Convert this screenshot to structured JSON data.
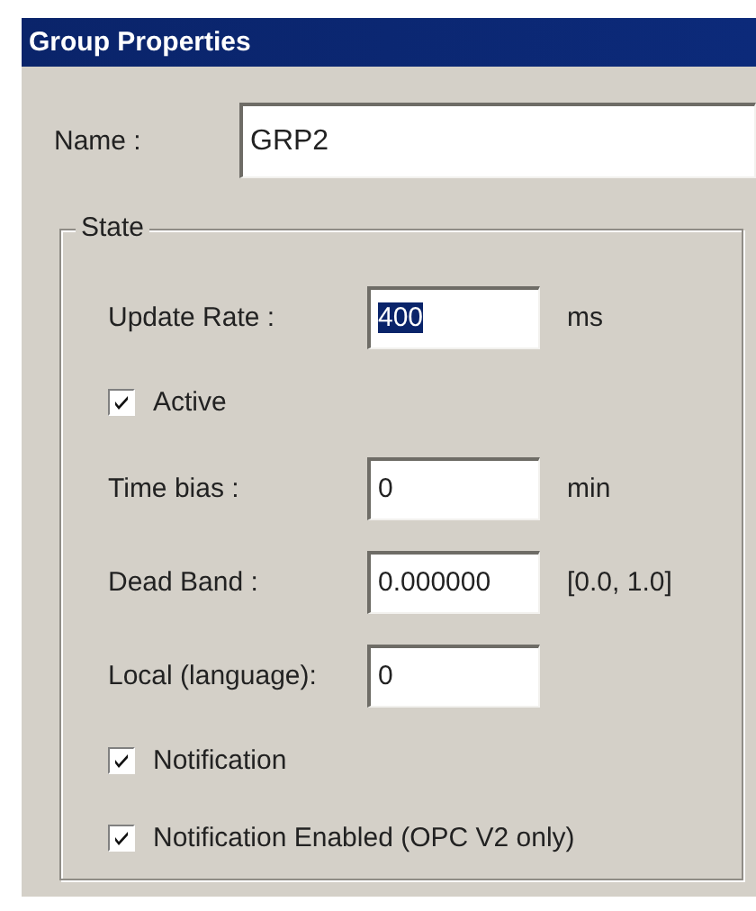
{
  "window": {
    "title": "Group Properties"
  },
  "name_field": {
    "label": "Name :",
    "value": "GRP2"
  },
  "state_group": {
    "title": "State",
    "rows": [
      {
        "kind": "field",
        "label": "Update Rate :",
        "value": "400",
        "highlighted": true,
        "unit": "ms"
      },
      {
        "kind": "checkbox",
        "label": "Active",
        "checked": true
      },
      {
        "kind": "field",
        "label": "Time bias :",
        "value": "0",
        "highlighted": false,
        "unit": "min"
      },
      {
        "kind": "field",
        "label": "Dead Band :",
        "value": "0.000000",
        "highlighted": false,
        "unit": "[0.0, 1.0]"
      },
      {
        "kind": "field",
        "label": "Local (language):",
        "value": "0",
        "highlighted": false
      },
      {
        "kind": "checkbox",
        "label": "Notification",
        "checked": true
      },
      {
        "kind": "checkbox",
        "label": "Notification Enabled (OPC V2 only)",
        "checked": true
      }
    ]
  }
}
